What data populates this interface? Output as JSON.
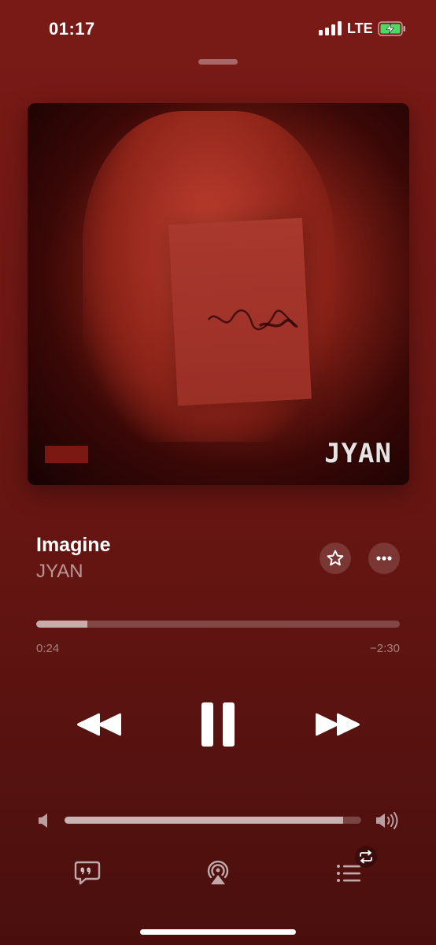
{
  "status_bar": {
    "time": "01:17",
    "network": "LTE",
    "battery_icon": "battery-charging-icon",
    "signal_icon": "cellular-signal-icon"
  },
  "now_playing": {
    "artwork_logo_text": "JYAN",
    "title": "Imagine",
    "artist": "JYAN",
    "favorite_icon": "star-icon",
    "more_icon": "ellipsis-icon"
  },
  "progress": {
    "elapsed": "0:24",
    "remaining": "−2:30",
    "fraction": 0.14
  },
  "controls": {
    "previous_icon": "rewind-icon",
    "play_pause_icon": "pause-icon",
    "next_icon": "fast-forward-icon"
  },
  "volume": {
    "level": 0.94,
    "min_icon": "speaker-low-icon",
    "max_icon": "speaker-high-icon"
  },
  "bottom_bar": {
    "lyrics_icon": "lyrics-icon",
    "airplay_icon": "airplay-icon",
    "queue_icon": "queue-icon",
    "repeat_badge_icon": "repeat-icon"
  },
  "colors": {
    "background": "#6e1714",
    "accent": "#ffffff"
  }
}
